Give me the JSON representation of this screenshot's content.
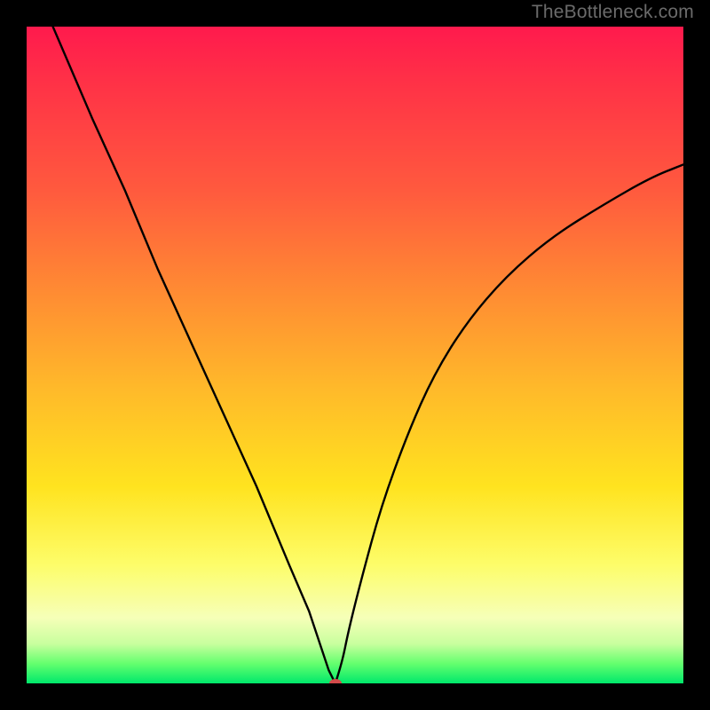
{
  "watermark": "TheBottleneck.com",
  "colors": {
    "frame": "#000000",
    "watermark_text": "#6b6b6b",
    "curve_stroke": "#000000",
    "marker": "#d24a4a",
    "gradient_stops": [
      "#ff1a4d",
      "#ff5a3e",
      "#ff8a33",
      "#ffb92a",
      "#ffe31f",
      "#fdfd6a",
      "#f6ffb8",
      "#64ff6e",
      "#00e86b"
    ]
  },
  "chart_data": {
    "type": "line",
    "title": "",
    "xlabel": "",
    "ylabel": "",
    "xlim": [
      0,
      100
    ],
    "ylim": [
      0,
      100
    ],
    "notes": "V-shaped bottleneck curve. Minimum (green zone) near x≈47 y≈0. Left branch steep/linear, right branch concave approaching asymptote. No axis ticks or labels are rendered; values are estimated from curve geometry.",
    "series": [
      {
        "name": "left_branch",
        "x": [
          4,
          10,
          15,
          20,
          25,
          30,
          35,
          40,
          43,
          45,
          46,
          47
        ],
        "values": [
          100,
          86,
          75,
          63,
          52,
          41,
          30,
          18,
          11,
          5,
          2,
          0
        ]
      },
      {
        "name": "right_branch",
        "x": [
          47,
          48,
          49,
          51,
          54,
          58,
          62,
          67,
          73,
          80,
          88,
          95,
          100
        ],
        "values": [
          0,
          3,
          8,
          16,
          27,
          38,
          47,
          55,
          62,
          68,
          73,
          77,
          79
        ]
      }
    ],
    "marker": {
      "x": 47,
      "y": 0
    }
  }
}
